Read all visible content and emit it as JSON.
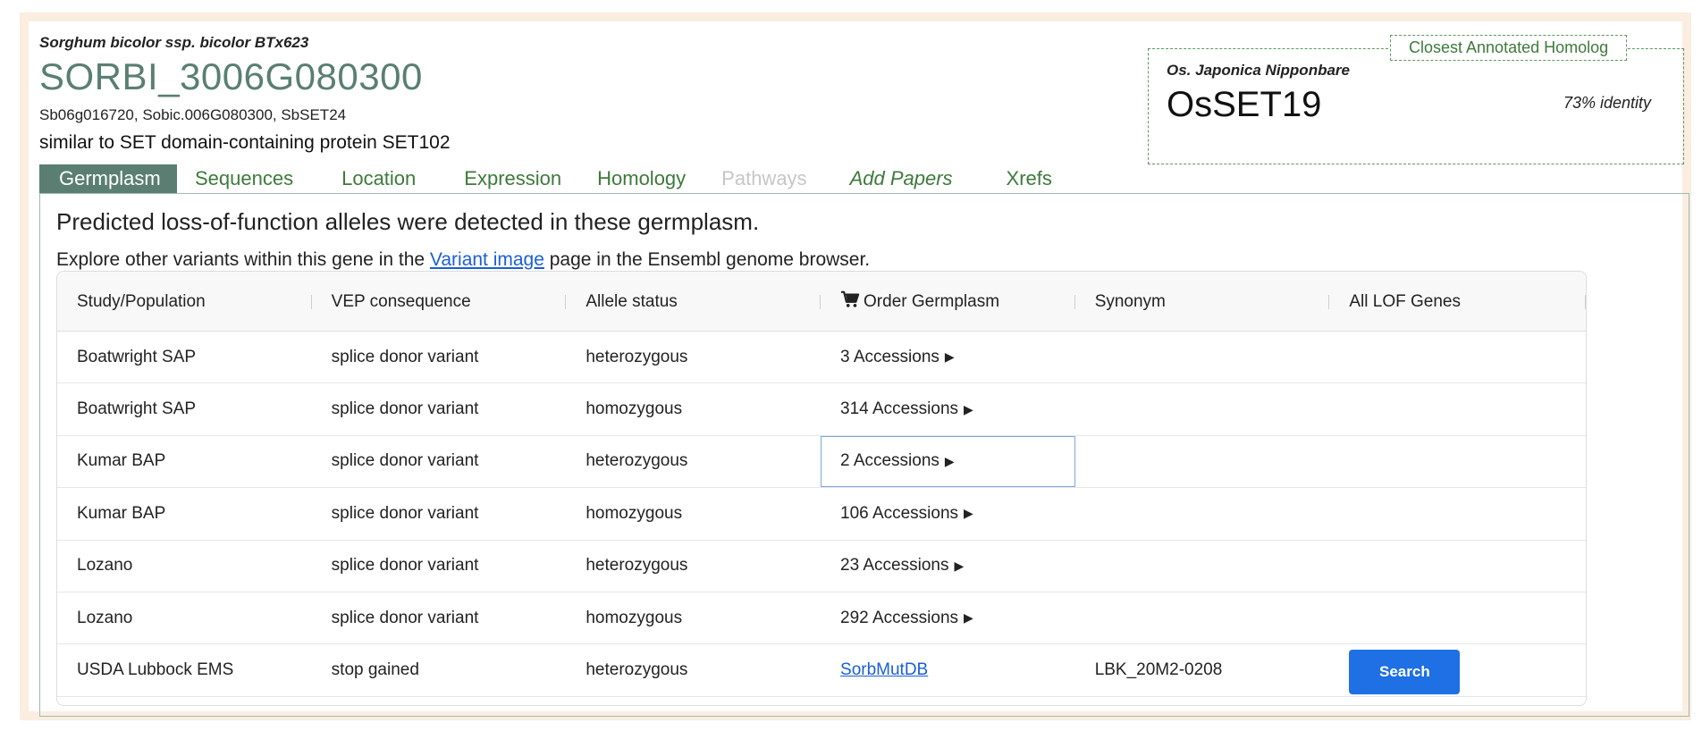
{
  "gene": {
    "species": "Sorghum bicolor ssp. bicolor BTx623",
    "id": "SORBI_3006G080300",
    "synonyms": "Sb06g016720, Sobic.006G080300, SbSET24",
    "description": "similar to SET domain-containing protein SET102"
  },
  "homolog": {
    "legend": "Closest Annotated Homolog",
    "species": "Os. Japonica Nipponbare",
    "name": "OsSET19",
    "identity": "73% identity"
  },
  "tabs": [
    {
      "label": "Germplasm",
      "state": "active"
    },
    {
      "label": "Sequences",
      "state": "normal"
    },
    {
      "label": "Location",
      "state": "normal"
    },
    {
      "label": "Expression",
      "state": "normal"
    },
    {
      "label": "Homology",
      "state": "normal"
    },
    {
      "label": "Pathways",
      "state": "disabled"
    },
    {
      "label": "Add Papers",
      "state": "italic"
    },
    {
      "label": "Xrefs",
      "state": "normal"
    }
  ],
  "panel": {
    "title": "Predicted loss-of-function alleles were detected in these germplasm.",
    "explore_prefix": "Explore other variants within this gene in the ",
    "explore_link": "Variant image",
    "explore_suffix": " page in the Ensembl genome browser."
  },
  "table": {
    "columns": [
      "Study/Population",
      "VEP consequence",
      "Allele status",
      "Order Germplasm",
      "Synonym",
      "All LOF Genes"
    ],
    "rows": [
      {
        "study": "Boatwright SAP",
        "vep": "splice donor variant",
        "status": "heterozygous",
        "order": "3 Accessions",
        "synonym": "",
        "lof": ""
      },
      {
        "study": "Boatwright SAP",
        "vep": "splice donor variant",
        "status": "homozygous",
        "order": "314 Accessions",
        "synonym": "",
        "lof": ""
      },
      {
        "study": "Kumar BAP",
        "vep": "splice donor variant",
        "status": "heterozygous",
        "order": "2 Accessions",
        "synonym": "",
        "lof": ""
      },
      {
        "study": "Kumar BAP",
        "vep": "splice donor variant",
        "status": "homozygous",
        "order": "106 Accessions",
        "synonym": "",
        "lof": ""
      },
      {
        "study": "Lozano",
        "vep": "splice donor variant",
        "status": "heterozygous",
        "order": "23 Accessions",
        "synonym": "",
        "lof": ""
      },
      {
        "study": "Lozano",
        "vep": "splice donor variant",
        "status": "homozygous",
        "order": "292 Accessions",
        "synonym": "",
        "lof": ""
      },
      {
        "study": "USDA Lubbock EMS",
        "vep": "stop gained",
        "status": "heterozygous",
        "order_link": "SorbMutDB",
        "synonym": "LBK_20M2-0208",
        "lof_button": "Search"
      }
    ],
    "arrow": "▶",
    "focused_row": 2
  },
  "icons": {
    "cart": "shopping-cart-icon",
    "expand": "triangle-right-icon"
  },
  "colors": {
    "gene_id": "#5a7f72",
    "tab_active_bg": "#5a7f72",
    "tab_text": "#3d7a3a",
    "link": "#1a5fd6",
    "button": "#1f6fe5",
    "frame": "#fbeee0"
  }
}
